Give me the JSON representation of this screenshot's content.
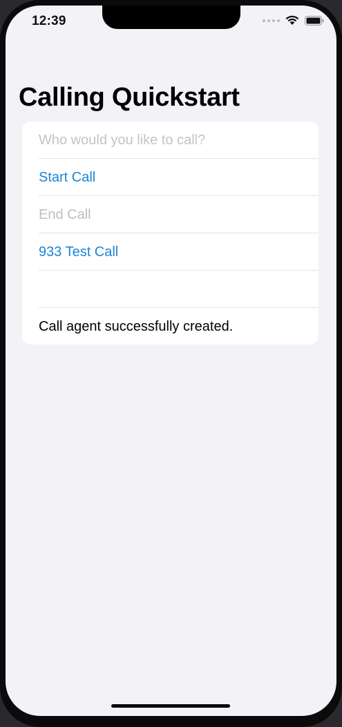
{
  "status_bar": {
    "time": "12:39",
    "icons": [
      "cellular-signal-icon",
      "wifi-icon",
      "battery-icon"
    ]
  },
  "page": {
    "title": "Calling Quickstart"
  },
  "form": {
    "callee_placeholder": "Who would you like to call?",
    "callee_value": "",
    "start_call_label": "Start Call",
    "end_call_label": "End Call",
    "test_call_label": "933 Test Call",
    "empty_row_text": "",
    "status_message": "Call agent successfully created."
  },
  "colors": {
    "accent": "#1c84d6",
    "disabled": "#bfbfc3",
    "background": "#f2f2f7"
  }
}
